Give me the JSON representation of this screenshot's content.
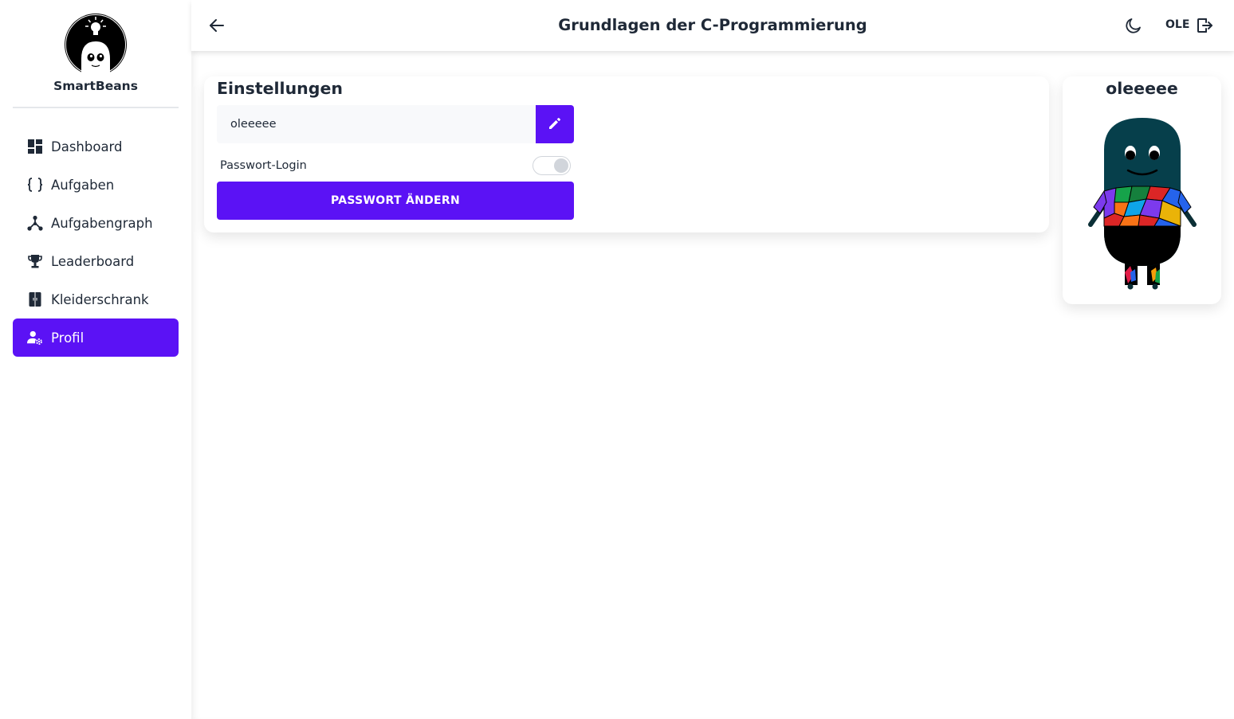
{
  "brand": {
    "name": "SmartBeans",
    "logo_icon": "bean-bulb-logo-icon"
  },
  "sidebar": {
    "items": [
      {
        "label": "Dashboard",
        "icon": "dashboard-icon",
        "active": false
      },
      {
        "label": "Aufgaben",
        "icon": "curly-braces-icon",
        "active": false
      },
      {
        "label": "Aufgabengraph",
        "icon": "graph-icon",
        "active": false
      },
      {
        "label": "Leaderboard",
        "icon": "trophy-icon",
        "active": false
      },
      {
        "label": "Kleiderschrank",
        "icon": "wardrobe-icon",
        "active": false
      },
      {
        "label": "Profil",
        "icon": "user-settings-icon",
        "active": true
      }
    ]
  },
  "topbar": {
    "title": "Grundlagen der C-Programmierung",
    "user": "OLE",
    "back_icon": "arrow-left-icon",
    "theme_icon": "moon-icon",
    "logout_icon": "logout-icon"
  },
  "settings": {
    "title": "Einstellungen",
    "username_value": "oleeeee",
    "edit_icon": "pencil-icon",
    "password_login_label": "Passwort-Login",
    "password_login_enabled": false,
    "change_password_label": "PASSWORT ÄNDERN"
  },
  "avatar": {
    "name": "oleeeee"
  },
  "colors": {
    "accent": "#5b12f5",
    "text": "#1f2937",
    "bean": "#063f4b"
  }
}
